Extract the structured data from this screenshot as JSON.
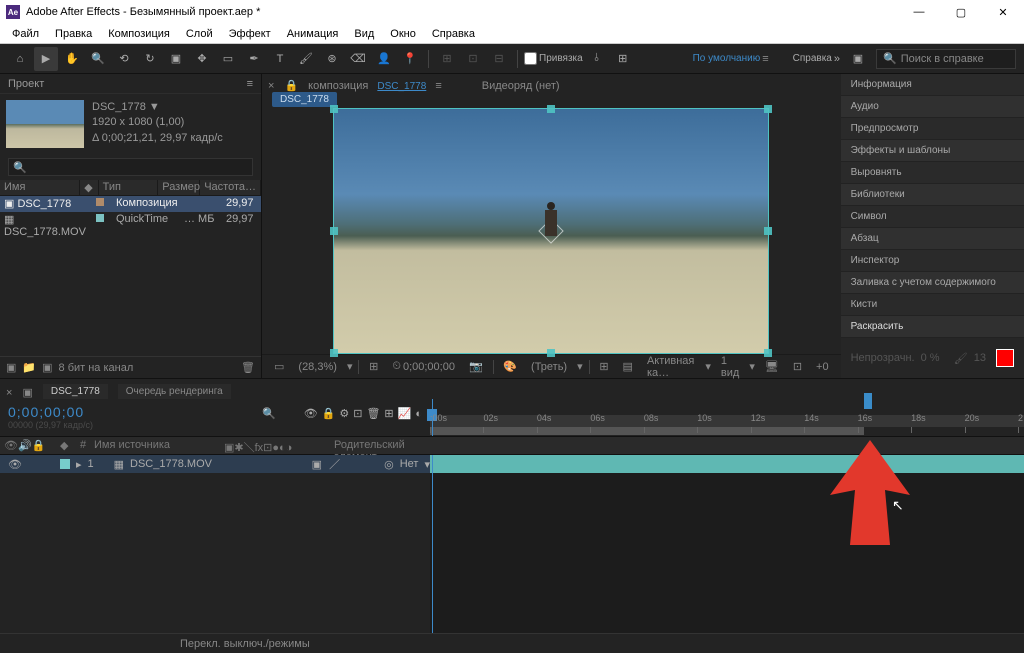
{
  "titlebar": {
    "app": "Adobe After Effects",
    "doc": "Безымянный проект.aep *"
  },
  "menu": [
    "Файл",
    "Правка",
    "Композиция",
    "Слой",
    "Эффект",
    "Анимация",
    "Вид",
    "Окно",
    "Справка"
  ],
  "toolbar": {
    "snap_label": "Привязка",
    "workspace": "По умолчанию",
    "help_label": "Справка",
    "search_placeholder": "Поиск в справке"
  },
  "project": {
    "panel_title": "Проект",
    "item_name": "DSC_1778 ▼",
    "resolution": "1920 x 1080 (1,00)",
    "duration": "Δ 0;00;21,21, 29,97 кадр/с",
    "cols": {
      "name": "Имя",
      "type": "Тип",
      "size": "Размер",
      "rate": "Частота…"
    },
    "rows": [
      {
        "name": "DSC_1778",
        "type": "Композиция",
        "size": "",
        "rate": "29,97",
        "color": "#b08b6a",
        "sel": true
      },
      {
        "name": "DSC_1778.MOV",
        "type": "QuickTime",
        "size": "… МБ",
        "rate": "29,97",
        "color": "#7cc2c2",
        "sel": false
      }
    ],
    "footer_bpc": "8 бит на канал"
  },
  "composition": {
    "tab_prefix": "композиция",
    "tab_name": "DSC_1778",
    "video_row": "Видеоряд",
    "video_row_val": "(нет)",
    "subtab": "DSC_1778",
    "controls": {
      "zoom": "(28,3%)",
      "time": "0;00;00;00",
      "mask_mode": "(Треть)",
      "camera": "Активная ка…",
      "views": "1 вид"
    }
  },
  "right_panels": [
    "Информация",
    "Аудио",
    "Предпросмотр",
    "Эффекты и шаблоны",
    "Выровнять",
    "Библиотеки",
    "Символ",
    "Абзац",
    "Инспектор",
    "Заливка с учетом содержимого",
    "Кисти",
    "Раскрасить"
  ],
  "right_footer": {
    "opacity_label": "Непрозрачн.",
    "opacity_val": "0 %",
    "flow_val": "13"
  },
  "timeline": {
    "tab": "DSC_1778",
    "render_queue": "Очередь рендеринга",
    "timecode": "0;00;00;00",
    "fps": "00000 (29,97 кадр/с)",
    "ruler": [
      ":00s",
      "02s",
      "04s",
      "06s",
      "08s",
      "10s",
      "12s",
      "14s",
      "16s",
      "18s",
      "20s",
      "2"
    ],
    "cols": {
      "src": "Имя источника",
      "parent": "Родительский элемент…",
      "none": "Нет"
    },
    "layers": [
      {
        "num": "1",
        "name": "DSC_1778.MOV"
      }
    ],
    "footer": "Перекл. выключ./режимы"
  }
}
